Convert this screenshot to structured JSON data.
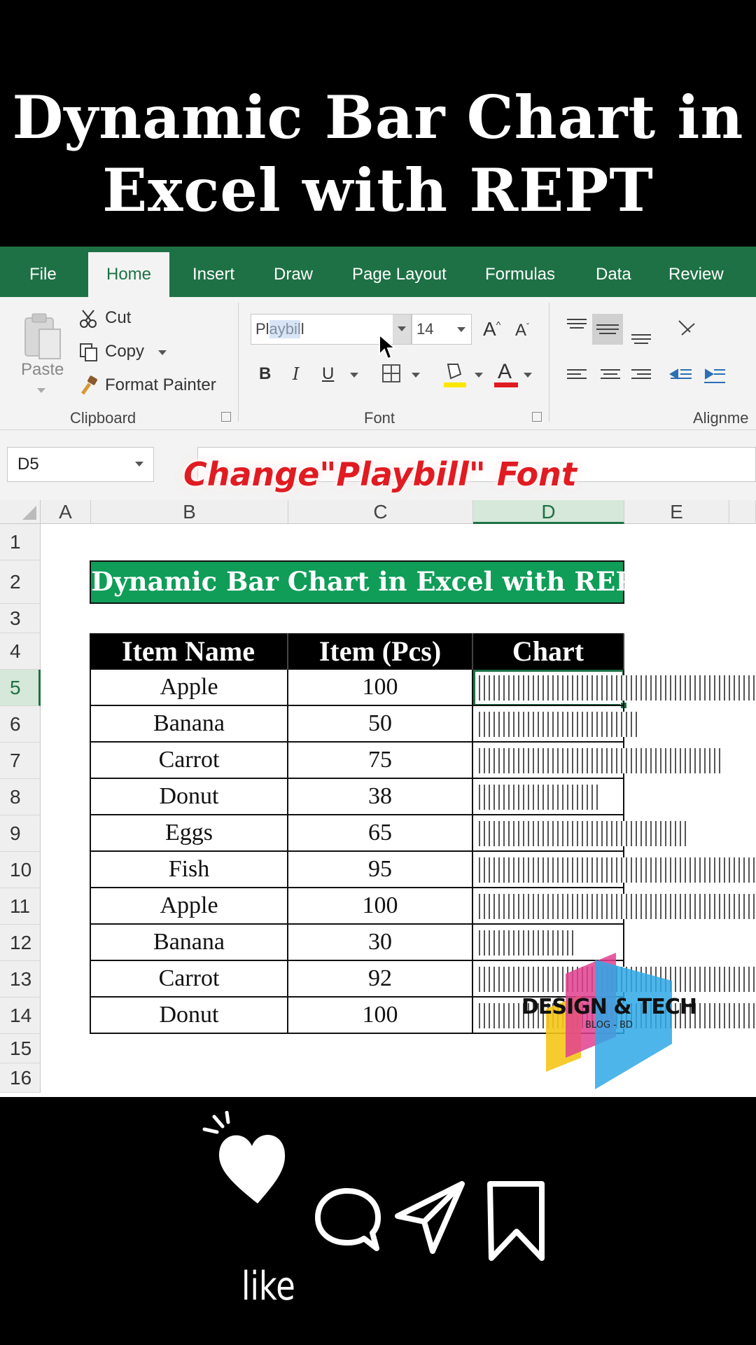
{
  "title": {
    "line1": "Dynamic Bar Chart in",
    "line2": "Excel with REPT"
  },
  "tabs": [
    "File",
    "Home",
    "Insert",
    "Draw",
    "Page Layout",
    "Formulas",
    "Data",
    "Review"
  ],
  "active_tab": "Home",
  "clipboard": {
    "paste": "Paste",
    "cut": "Cut",
    "copy": "Copy",
    "format_painter": "Format Painter",
    "group": "Clipboard"
  },
  "font": {
    "name_value": "Playbill",
    "size_value": "14",
    "bold": "B",
    "italic": "I",
    "underline": "U",
    "group": "Font"
  },
  "alignment": {
    "group": "Alignme"
  },
  "name_box": "D5",
  "caption": "Change\"Playbill\" Font",
  "columns": [
    "A",
    "B",
    "C",
    "D",
    "E"
  ],
  "rows": [
    "1",
    "2",
    "3",
    "4",
    "5",
    "6",
    "7",
    "8",
    "9",
    "10",
    "11",
    "12",
    "13",
    "14",
    "15",
    "16"
  ],
  "banner": "Dynamic Bar Chart in Excel with REPT",
  "table": {
    "headers": [
      "Item Name",
      "Item (Pcs)",
      "Chart"
    ],
    "items": [
      {
        "name": "Apple",
        "pcs": 100
      },
      {
        "name": "Banana",
        "pcs": 50
      },
      {
        "name": "Carrot",
        "pcs": 75
      },
      {
        "name": "Donut",
        "pcs": 38
      },
      {
        "name": "Eggs",
        "pcs": 65
      },
      {
        "name": "Fish",
        "pcs": 95
      },
      {
        "name": "Apple",
        "pcs": 100
      },
      {
        "name": "Banana",
        "pcs": 30
      },
      {
        "name": "Carrot",
        "pcs": 92
      },
      {
        "name": "Donut",
        "pcs": 100
      }
    ]
  },
  "logo": {
    "name": "DESIGN & TECH",
    "sub": "BLOG - BD"
  },
  "social": {
    "like": "like"
  },
  "colors": {
    "excel_green": "#1e7145",
    "banner_green": "#0f9d58",
    "caption_red": "#e11b22"
  }
}
